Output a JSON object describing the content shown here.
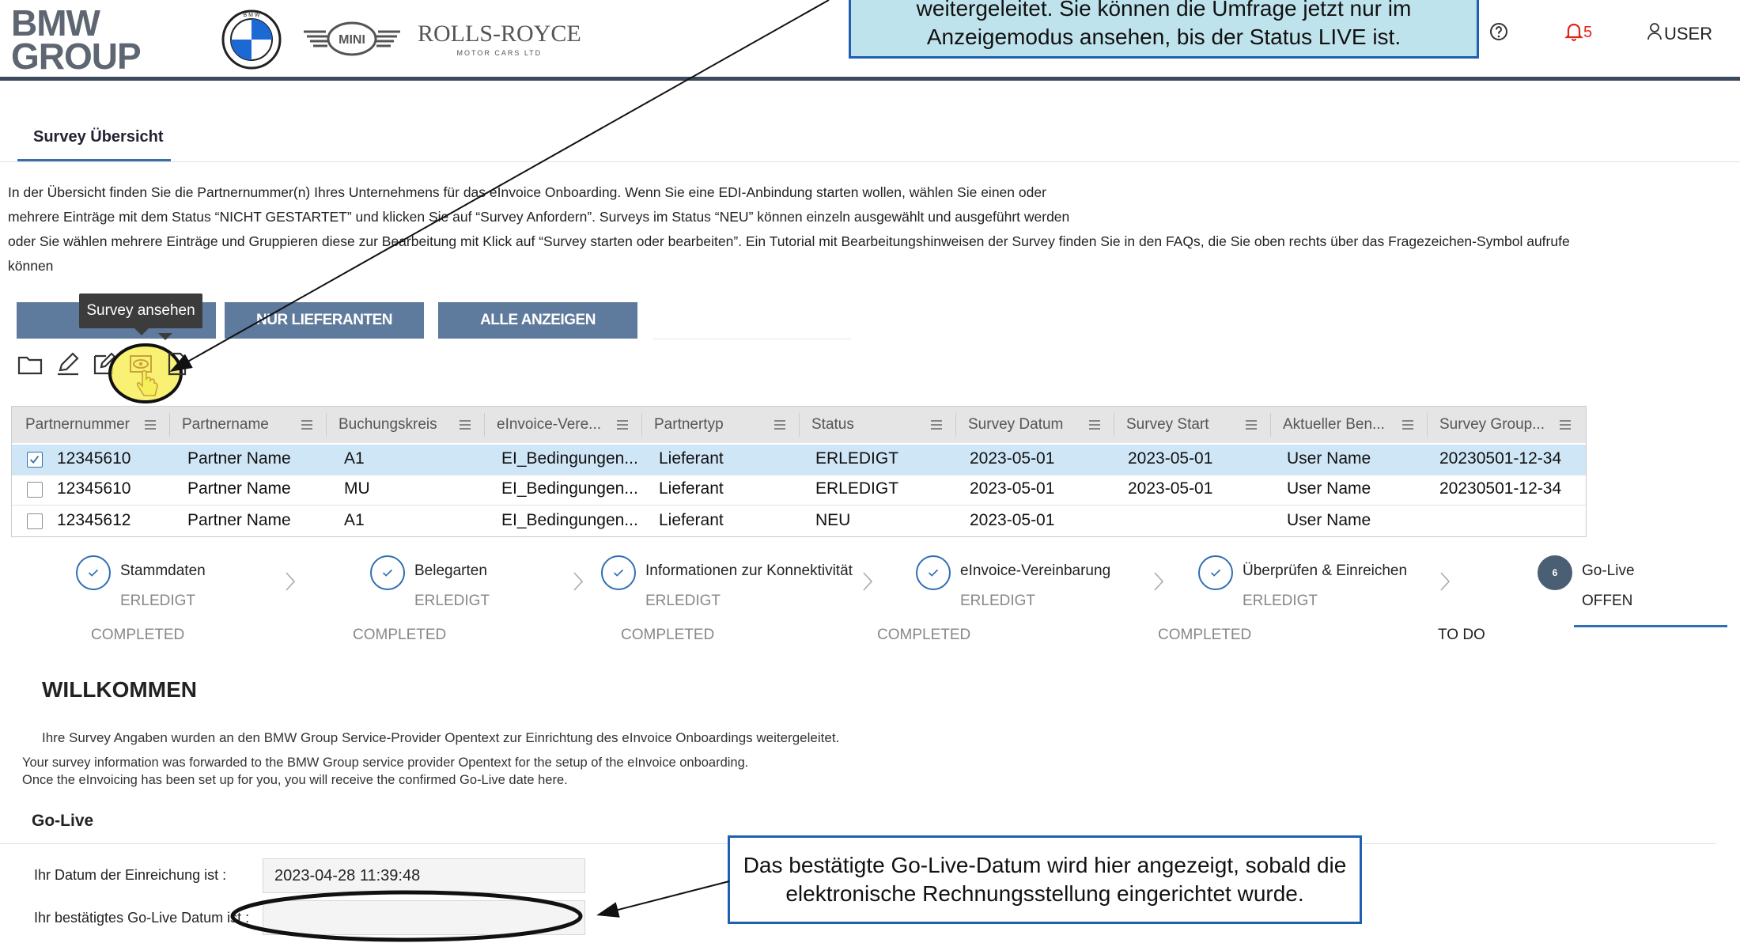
{
  "header": {
    "logo_text_1": "BMW",
    "logo_text_2": "GROUP",
    "mini_label": "MINI",
    "rr_name": "ROLLS-ROYCE",
    "rr_sub": "MOTOR CARS LTD",
    "help_icon": "question-circle-icon",
    "notification_count": "5",
    "user_label": "USER",
    "accent_color": "#3b4a5c"
  },
  "top_callout": {
    "line1": "weitergeleitet. Sie können die Umfrage jetzt nur im",
    "line2": "Anzeigemodus ansehen, bis der Status LIVE ist."
  },
  "tab": {
    "label": "Survey Übersicht"
  },
  "intro": {
    "line1": "In der Übersicht finden Sie die Partnernummer(n) Ihres Unternehmens für das eInvoice Onboarding. Wenn Sie eine EDI-Anbindung starten wollen, wählen Sie einen oder",
    "line2": "mehrere Einträge mit dem Status “NICHT GESTARTET” und klicken Sie auf “Survey Anfordern”. Surveys im Status “NEU” können einzeln ausgewählt und ausgeführt werden",
    "line3": "oder Sie wählen mehrere Einträge und Gruppieren diese zur Bearbeitung mit Klick auf “Survey starten oder bearbeiten”. Ein Tutorial mit Bearbeitungshinweisen der Survey finden Sie in den FAQs, die Sie oben rechts über das Fragezeichen-Symbol aufrufe",
    "line4": "können"
  },
  "buttons": {
    "nur_lieferanten": "NUR LIEFERANTEN",
    "alle_anzeigen": "ALLE ANZEIGEN",
    "button_color": "#5e7a9d"
  },
  "tooltip": {
    "text": "Survey ansehen"
  },
  "toolbar_icons": [
    "folder-icon",
    "pencil-icon",
    "edit-box-icon",
    "view-survey-icon",
    "document-icon"
  ],
  "table": {
    "columns": [
      "Partnernummer",
      "Partnername",
      "Buchungskreis",
      "eInvoice-Vere...",
      "Partnertyp",
      "Status",
      "Survey Datum",
      "Survey Start",
      "Aktueller Ben...",
      "Survey Group..."
    ],
    "rows": [
      [
        "12345610",
        "Partner Name",
        "A1",
        "EI_Bedingungen...",
        "Lieferant",
        "ERLEDIGT",
        "2023-05-01",
        "2023-05-01",
        "User Name",
        "20230501-12-34"
      ],
      [
        "12345610",
        "Partner Name",
        "MU",
        "EI_Bedingungen...",
        "Lieferant",
        "ERLEDIGT",
        "2023-05-01",
        "2023-05-01",
        "User Name",
        "20230501-12-34"
      ],
      [
        "12345612",
        "Partner Name",
        "A1",
        "EI_Bedingungen...",
        "Lieferant",
        "NEU",
        "2023-05-01",
        "",
        "User Name",
        ""
      ]
    ],
    "selected_row_color": "#cfe6f7"
  },
  "steps": [
    {
      "title": "Stammdaten",
      "state": "ERLEDIGT",
      "completion": "COMPLETED"
    },
    {
      "title": "Belegarten",
      "state": "ERLEDIGT",
      "completion": "COMPLETED"
    },
    {
      "title": "Informationen zur Konnektivität",
      "state": "ERLEDIGT",
      "completion": "COMPLETED"
    },
    {
      "title": "eInvoice-Vereinbarung",
      "state": "ERLEDIGT",
      "completion": "COMPLETED"
    },
    {
      "title": "Überprüfen & Einreichen",
      "state": "ERLEDIGT",
      "completion": "COMPLETED"
    },
    {
      "title": "Go-Live",
      "state": "OFFEN",
      "completion": "TO DO",
      "number": "6"
    }
  ],
  "welcome": {
    "title": "WILLKOMMEN",
    "de_text": "Ihre Survey Angaben wurden an den BMW Group Service-Provider Opentext zur Einrichtung des eInvoice Onboardings weitergeleitet.",
    "en_line1": "Your survey information was forwarded to the BMW Group service provider Opentext for the setup of the eInvoice onboarding.",
    "en_line2": "Once the eInvoicing has been set up for you, you will receive the confirmed Go-Live date here."
  },
  "golive": {
    "heading": "Go-Live",
    "submission_label": "Ihr Datum der Einreichung ist :",
    "submission_value": "2023-04-28 11:39:48",
    "confirmed_label": "Ihr bestätigtes Go-Live Datum ist :",
    "confirmed_value": ""
  },
  "bottom_callout": {
    "line1": "Das bestätigte Go-Live-Datum wird hier angezeigt, sobald die",
    "line2": "elektronische Rechnungsstellung eingerichtet wurde."
  }
}
